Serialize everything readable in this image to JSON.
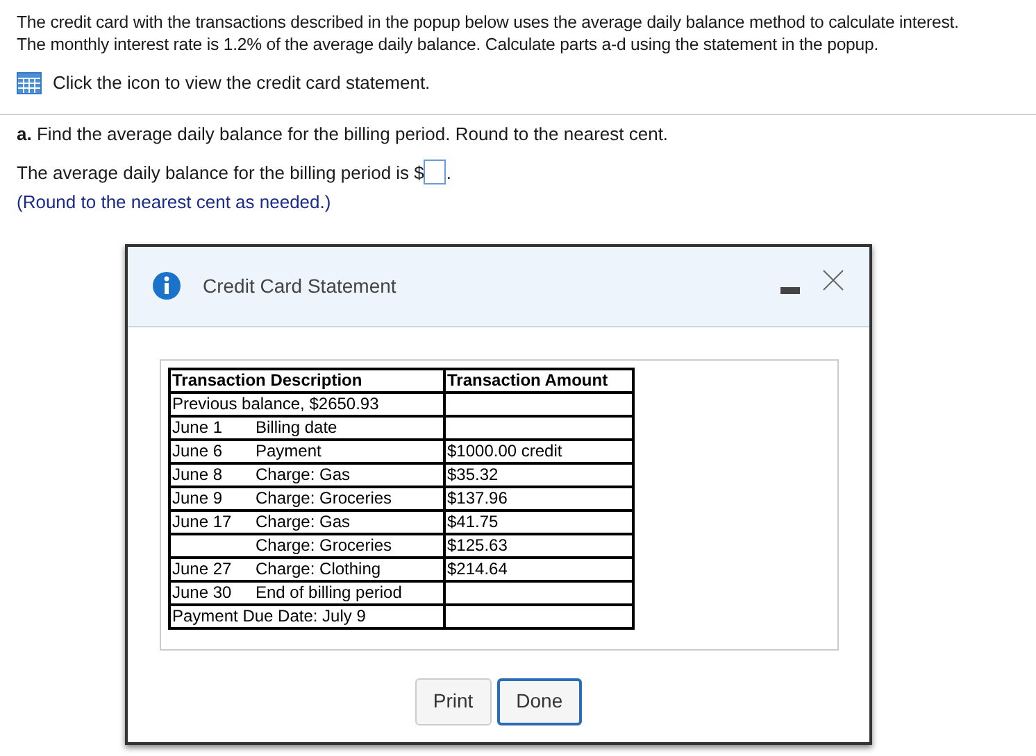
{
  "intro": [
    "The credit card with the transactions described in the popup below uses the average daily balance method to calculate interest.",
    "The monthly interest rate is 1.2% of the average daily balance.  Calculate parts a-d using the statement in the popup."
  ],
  "statement_link": "Click the icon to view the credit card statement.",
  "question": {
    "label": "a.",
    "text": "Find the average daily balance for the billing period.  Round to the nearest cent.",
    "answer_prefix": "The average daily balance for the billing period is $",
    "answer_suffix": ".",
    "hint": "(Round to the nearest cent as needed.)"
  },
  "dialog": {
    "title": "Credit Card Statement",
    "table": {
      "columns": [
        "Transaction Description",
        "Transaction Amount"
      ],
      "rows": [
        {
          "kind": "span",
          "description": "Previous balance, $2650.93"
        },
        {
          "kind": "dated",
          "date": "June 1",
          "description": "Billing date"
        },
        {
          "kind": "dated",
          "date": "June 6",
          "description": "Payment",
          "amount": "$1000.00 credit"
        },
        {
          "kind": "dated",
          "date": "June 8",
          "description": "Charge: Gas",
          "amount": "$35.32"
        },
        {
          "kind": "dated",
          "date": "June 9",
          "description": "Charge: Groceries",
          "amount": "$137.96"
        },
        {
          "kind": "dated",
          "date": "June 17",
          "description": "Charge: Gas",
          "amount": "$41.75"
        },
        {
          "kind": "dated",
          "description": "Charge: Groceries",
          "amount": "$125.63"
        },
        {
          "kind": "dated",
          "date": "June 27",
          "description": "Charge: Clothing",
          "amount": "$214.64"
        },
        {
          "kind": "dated",
          "date": "June 30",
          "description": "End of billing period"
        },
        {
          "kind": "span",
          "description": "Payment Due Date: July 9"
        }
      ]
    },
    "buttons": [
      {
        "label": "Print",
        "selected": false
      },
      {
        "label": "Done",
        "selected": true
      }
    ]
  }
}
